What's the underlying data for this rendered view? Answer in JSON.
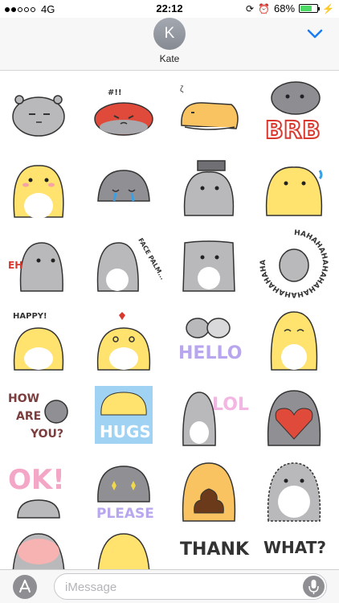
{
  "status_bar": {
    "carrier": "4G",
    "time": "22:12",
    "battery_percent": "68%",
    "battery_level": 0.68,
    "signal_bars_filled": 2,
    "signal_bars_total": 5
  },
  "header": {
    "avatar_initial": "K",
    "contact_name": "Kate"
  },
  "stickers": {
    "brb": "BRB",
    "facepalm": "FACE PALM...",
    "eh": "EH",
    "laughing": "HAHAHAHAHAHAHAHAHAHAHAHA",
    "happy": "HAPPY!",
    "hello": "HELLO",
    "lol": "LOL",
    "how_are_you_1": "HOW",
    "how_are_you_2": "ARE",
    "how_are_you_3": "YOU?",
    "hugs": "HUGS",
    "ok": "OK!",
    "please": "PLEASE",
    "thank": "THANK",
    "what": "WHAT?",
    "zzz": "#!!"
  },
  "input": {
    "placeholder": "iMessage"
  },
  "colors": {
    "gray_hamster": "#b9b9bb",
    "yellow_hamster": "#ffe36e",
    "orange_hamster": "#f8c360",
    "red": "#e04a3a",
    "ios_blue": "#1a7cf5",
    "hugs_blue": "#9fd2f3"
  }
}
